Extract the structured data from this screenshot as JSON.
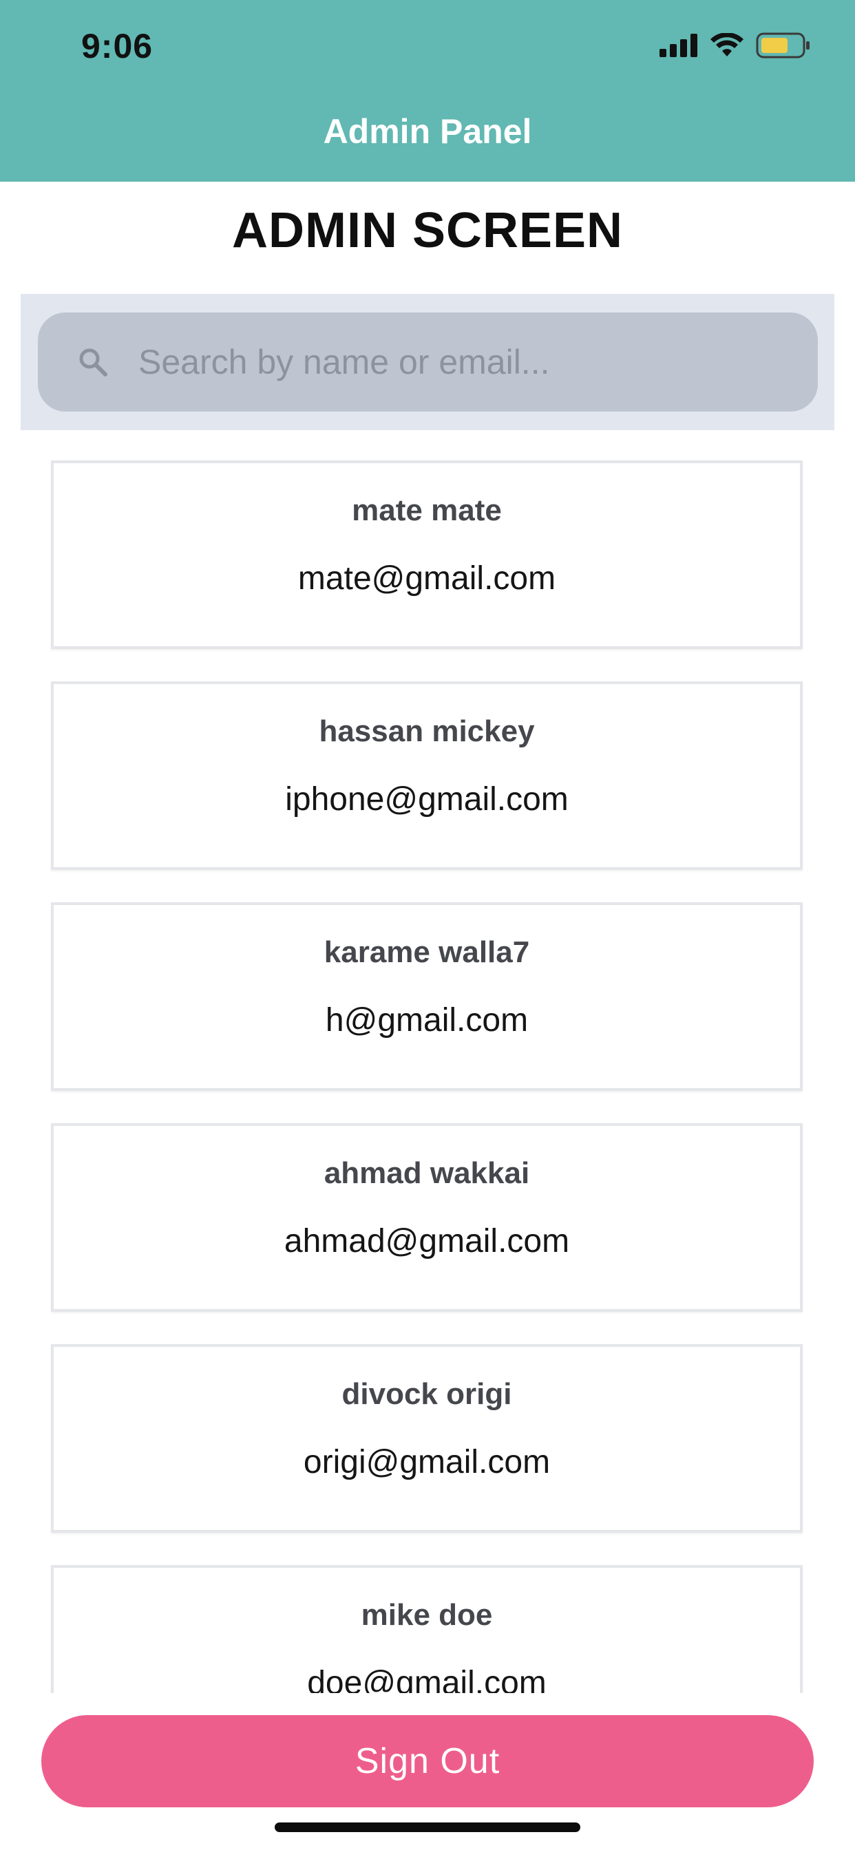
{
  "status_bar": {
    "time": "9:06",
    "icons": [
      "cellular-signal-icon",
      "wifi-icon",
      "battery-icon"
    ],
    "battery_color": "#f2cd47"
  },
  "header": {
    "title": "Admin Panel",
    "background_color": "#62b8b2"
  },
  "page": {
    "title": "ADMIN SCREEN"
  },
  "search": {
    "value": "",
    "placeholder": "Search by name or email...",
    "icon": "search-icon"
  },
  "users": [
    {
      "name": "mate mate",
      "email": "mate@gmail.com"
    },
    {
      "name": "hassan mickey",
      "email": "iphone@gmail.com"
    },
    {
      "name": "karame walla7",
      "email": "h@gmail.com"
    },
    {
      "name": "ahmad wakkai",
      "email": "ahmad@gmail.com"
    },
    {
      "name": "divock origi",
      "email": "origi@gmail.com"
    },
    {
      "name": "mike doe",
      "email": "doe@gmail.com"
    }
  ],
  "actions": {
    "sign_out_label": "Sign Out",
    "sign_out_color": "#ee5e8d"
  }
}
